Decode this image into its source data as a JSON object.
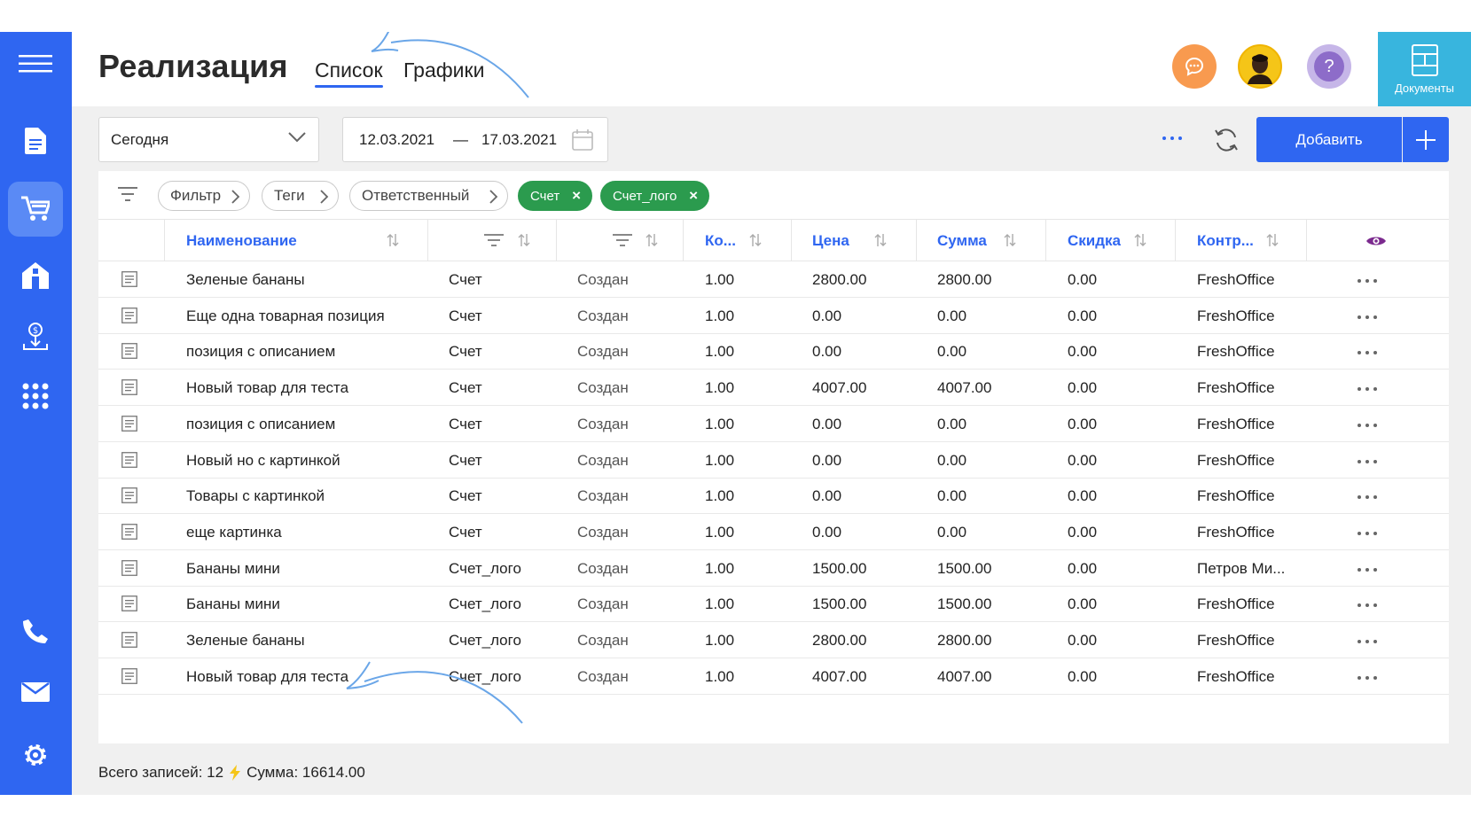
{
  "app": {
    "title": "Реализация",
    "tabs": [
      {
        "label": "Список",
        "active": true
      },
      {
        "label": "Графики",
        "active": false
      }
    ],
    "docs_button": "Документы",
    "help_label": "?"
  },
  "sidebar": {
    "items": [
      {
        "icon": "menu-icon"
      },
      {
        "icon": "document-icon"
      },
      {
        "icon": "cart-icon",
        "active": true
      },
      {
        "icon": "store-icon"
      },
      {
        "icon": "money-download-icon"
      },
      {
        "icon": "apps-grid-icon"
      },
      {
        "icon": "phone-icon"
      },
      {
        "icon": "mail-icon"
      },
      {
        "icon": "gear-icon"
      }
    ]
  },
  "toolbar": {
    "period": "Сегодня",
    "date_from": "12.03.2021",
    "date_sep": "—",
    "date_to": "17.03.2021",
    "add_label": "Добавить"
  },
  "filters": {
    "chips": [
      "Фильтр",
      "Теги",
      "Ответственный"
    ],
    "active_tags": [
      "Счет",
      "Счет_лого"
    ]
  },
  "table": {
    "columns": [
      "Наименование",
      "",
      "",
      "Ко...",
      "Цена",
      "Сумма",
      "Скидка",
      "Контр..."
    ],
    "rows": [
      [
        "Зеленые бананы",
        "Счет",
        "Создан",
        "1.00",
        "2800.00",
        "2800.00",
        "0.00",
        "FreshOffice"
      ],
      [
        "Еще одна товарная позиция",
        "Счет",
        "Создан",
        "1.00",
        "0.00",
        "0.00",
        "0.00",
        "FreshOffice"
      ],
      [
        "позиция с описанием",
        "Счет",
        "Создан",
        "1.00",
        "0.00",
        "0.00",
        "0.00",
        "FreshOffice"
      ],
      [
        "Новый товар для теста",
        "Счет",
        "Создан",
        "1.00",
        "4007.00",
        "4007.00",
        "0.00",
        "FreshOffice"
      ],
      [
        "позиция с описанием",
        "Счет",
        "Создан",
        "1.00",
        "0.00",
        "0.00",
        "0.00",
        "FreshOffice"
      ],
      [
        "Новый но с картинкой",
        "Счет",
        "Создан",
        "1.00",
        "0.00",
        "0.00",
        "0.00",
        "FreshOffice"
      ],
      [
        "Товары с картинкой",
        "Счет",
        "Создан",
        "1.00",
        "0.00",
        "0.00",
        "0.00",
        "FreshOffice"
      ],
      [
        "еще картинка",
        "Счет",
        "Создан",
        "1.00",
        "0.00",
        "0.00",
        "0.00",
        "FreshOffice"
      ],
      [
        "Бананы мини",
        "Счет_лого",
        "Создан",
        "1.00",
        "1500.00",
        "1500.00",
        "0.00",
        "Петров Ми..."
      ],
      [
        "Бананы мини",
        "Счет_лого",
        "Создан",
        "1.00",
        "1500.00",
        "1500.00",
        "0.00",
        "FreshOffice"
      ],
      [
        "Зеленые бананы",
        "Счет_лого",
        "Создан",
        "1.00",
        "2800.00",
        "2800.00",
        "0.00",
        "FreshOffice"
      ],
      [
        "Новый товар для теста",
        "Счет_лого",
        "Создан",
        "1.00",
        "4007.00",
        "4007.00",
        "0.00",
        "FreshOffice"
      ]
    ]
  },
  "footer": {
    "total_label": "Всего записей: 12",
    "sum_label": "Сумма: 16614.00"
  },
  "colors": {
    "accent": "#2f66f1",
    "docs": "#38b5de",
    "tag_green": "#2b9b4e",
    "chat": "#f89a4f",
    "help": "#8d6cc9"
  }
}
